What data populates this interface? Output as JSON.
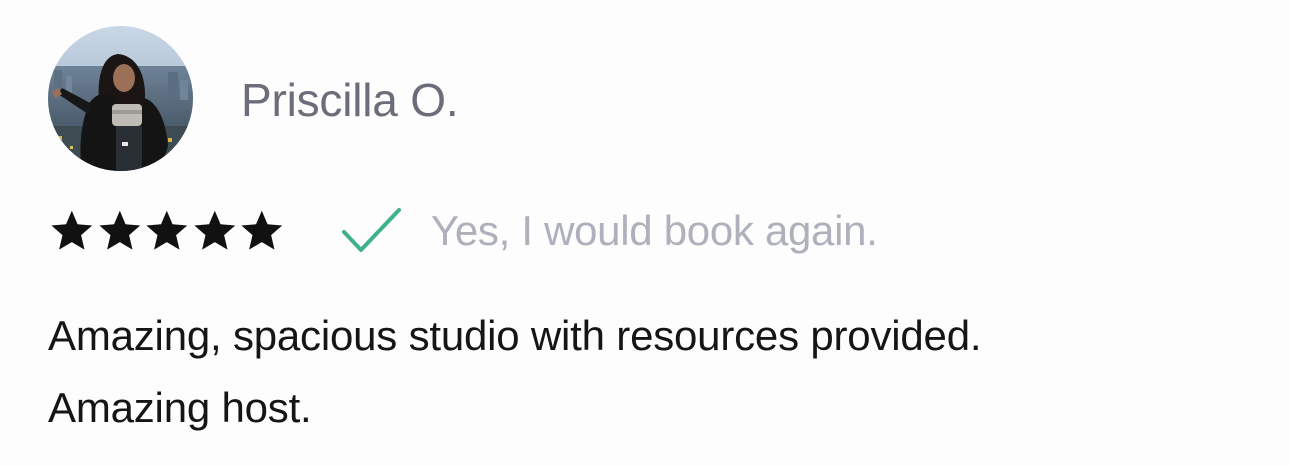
{
  "reviewer": {
    "name": "Priscilla O.",
    "avatar_icon": "user-photo-avatar"
  },
  "rating": {
    "stars": 5,
    "max_stars": 5,
    "star_color": "#111111"
  },
  "rebook": {
    "icon": "checkmark-icon",
    "icon_color": "#3fb28a",
    "text": "Yes, I would book again."
  },
  "review": {
    "lines": [
      "Amazing, spacious studio with resources provided.",
      "Amazing host."
    ]
  }
}
